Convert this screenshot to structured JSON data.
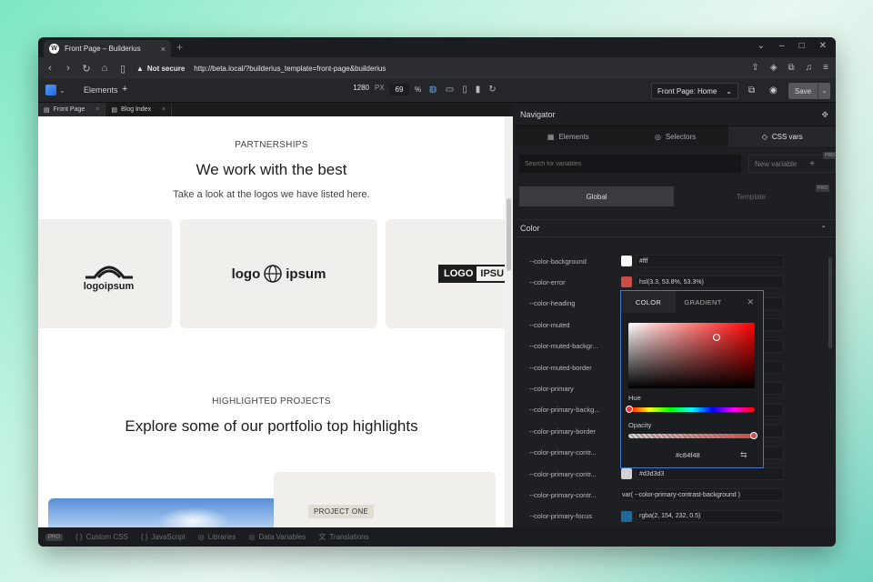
{
  "browser": {
    "tab_title": "Front Page – Builderius",
    "security": "Not secure",
    "url": "http://beta.local/?builderius_template=front-page&builderius"
  },
  "toolbar": {
    "elements_label": "Elements",
    "width_value": "1280",
    "width_unit": "PX",
    "zoom_value": "69",
    "zoom_unit": "%",
    "page_select": "Front Page: Home",
    "save_label": "Save"
  },
  "canvas_tabs": [
    {
      "label": "Front Page"
    },
    {
      "label": "Blog Index"
    }
  ],
  "canvas": {
    "partnerships": {
      "label": "PARTNERSHIPS",
      "title": "We work with the best",
      "subtitle": "Take a look at the logos we have listed here."
    },
    "logos": [
      "logoipsum",
      "logo",
      "ipsum",
      "LOGO",
      "IPSU"
    ],
    "projects": {
      "label": "HIGHLIGHTED PROJECTS",
      "title": "Explore some of our portfolio top highlights",
      "badge": "PROJECT ONE"
    }
  },
  "panel": {
    "title": "Navigator",
    "tabs": [
      {
        "label": "Elements"
      },
      {
        "label": "Selectors"
      },
      {
        "label": "CSS vars"
      }
    ],
    "search_placeholder": "Search for variables",
    "new_variable": "New variable",
    "pro": "PRO",
    "scope": {
      "global": "Global",
      "template": "Template"
    },
    "section": "Color",
    "variables": [
      {
        "name": "--color-background",
        "swatch": "#ffffff",
        "value": "#fff"
      },
      {
        "name": "--color-error",
        "swatch": "#c84f48",
        "value": "hsl(3.3, 53.8%, 53.3%)"
      },
      {
        "name": "--color-heading",
        "swatch": "",
        "value": ""
      },
      {
        "name": "--color-muted",
        "swatch": "",
        "value": ""
      },
      {
        "name": "--color-muted-backgr...",
        "swatch": "",
        "value": ""
      },
      {
        "name": "--color-muted-border",
        "swatch": "",
        "value": ""
      },
      {
        "name": "--color-primary",
        "swatch": "",
        "value": ""
      },
      {
        "name": "--color-primary-backg...",
        "swatch": "",
        "value": ""
      },
      {
        "name": "--color-primary-border",
        "swatch": "",
        "value": ""
      },
      {
        "name": "--color-primary-contr...",
        "swatch": "",
        "value": ""
      },
      {
        "name": "--color-primary-contr...",
        "swatch": "#d3d3d3",
        "value": "#d3d3d3"
      },
      {
        "name": "--color-primary-contr...",
        "swatch": "",
        "value": "var( --color-primary-contrast-background )"
      },
      {
        "name": "--color-primary-focus",
        "swatch": "#1e6a9a",
        "value": "rgba(2, 154, 232, 0.5)"
      }
    ]
  },
  "picker": {
    "tab_color": "COLOR",
    "tab_gradient": "GRADIENT",
    "hue_label": "Hue",
    "opacity_label": "Opacity",
    "hex": "#c84f48",
    "hue_level": 0.0,
    "opacity_level": 1.0
  },
  "bottombar": {
    "pro": "PRO",
    "items": [
      {
        "label": "Custom CSS",
        "icon": "braces-icon"
      },
      {
        "label": "JavaScript",
        "icon": "braces-icon"
      },
      {
        "label": "Libraries",
        "icon": "database-icon"
      },
      {
        "label": "Data Variables",
        "icon": "database-icon"
      },
      {
        "label": "Translations",
        "icon": "translate-icon"
      }
    ]
  }
}
